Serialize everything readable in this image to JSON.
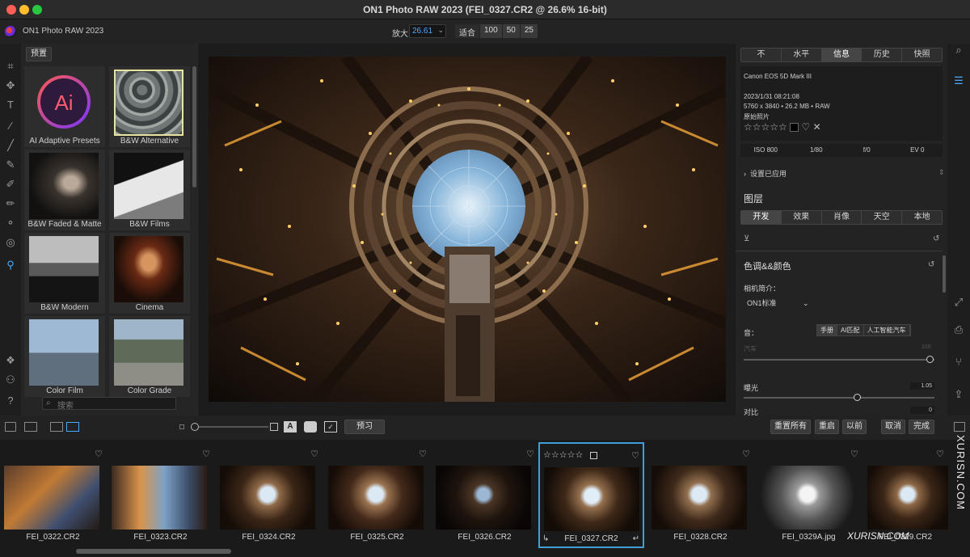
{
  "window": {
    "title": "ON1 Photo RAW 2023 (FEI_0327.CR2 @ 26.6% 16-bit)",
    "traffic_colors": [
      "#ff5f57",
      "#febc2e",
      "#28c840"
    ]
  },
  "toolbar": {
    "app_name": "ON1 Photo RAW 2023",
    "zoom_label": "放大",
    "zoom_value": "26.61",
    "fit_options": [
      "适合",
      "100",
      "50",
      "25"
    ]
  },
  "browser": {
    "preset_button": "预置",
    "presets": [
      {
        "label": "AI Adaptive Presets",
        "icon": "ai-icon"
      },
      {
        "label": "B&W Alternative"
      },
      {
        "label": "B&W Faded & Matte"
      },
      {
        "label": "B&W Films"
      },
      {
        "label": "B&W Modern"
      },
      {
        "label": "Cinema"
      },
      {
        "label": "Color Film"
      },
      {
        "label": "Color Grade"
      }
    ],
    "ai_logo_text": "Ai",
    "search_placeholder": "搜索"
  },
  "right_panel": {
    "info_tabs": [
      "不",
      "水平",
      "信息",
      "历史",
      "快照"
    ],
    "info_selected": "信息",
    "camera": "Canon EOS 5D Mark III",
    "datetime": "2023/1/31  08:21:08",
    "dims": "5760 x 3840 • 26.2 MB • RAW",
    "original": "原始照片",
    "stars": "☆☆☆☆☆",
    "exif": [
      "ISO 800",
      "1/80",
      "f/0",
      "EV 0"
    ],
    "settings_applied": "设置已应用",
    "layers_title": "图层",
    "layer_tabs": [
      "开发",
      "效果",
      "肖像",
      "天空",
      "本地"
    ],
    "layer_selected": "开发",
    "tone_title": "色调&&颜色",
    "camera_profile_label": "相机简介：",
    "camera_profile_value": "ON1标准",
    "tone_label": "音：",
    "tone_modes": [
      "手册",
      "AI匹配",
      "人工智能汽车"
    ],
    "tone_mode_selected": "手册",
    "auto_label": "汽车",
    "auto_value": "100",
    "exposure_label": "曝光",
    "exposure_value": "1.05",
    "contrast_label": "对比",
    "contrast_value": "0"
  },
  "bottom_bar": {
    "preview_button": "预习",
    "reset_all": "重置所有",
    "reset": "重启",
    "previous": "以前",
    "cancel": "取消",
    "done": "完成"
  },
  "filmstrip": {
    "items": [
      {
        "name": "FEI_0322.CR2",
        "selected": false
      },
      {
        "name": "FEI_0323.CR2",
        "selected": false
      },
      {
        "name": "FEI_0324.CR2",
        "selected": false
      },
      {
        "name": "FEI_0325.CR2",
        "selected": false
      },
      {
        "name": "FEI_0326.CR2",
        "selected": false
      },
      {
        "name": "FEI_0327.CR2",
        "selected": true
      },
      {
        "name": "FEI_0328.CR2",
        "selected": false
      },
      {
        "name": "FEI_0329A.jpg",
        "selected": false
      },
      {
        "name": "FEI_0329.CR2",
        "selected": false
      }
    ],
    "selected_stars": "☆☆☆☆☆",
    "accent": "#3f9fd6"
  },
  "watermark": {
    "vertical": "XURISN.COM",
    "horizontal": "XURISN.COM"
  }
}
